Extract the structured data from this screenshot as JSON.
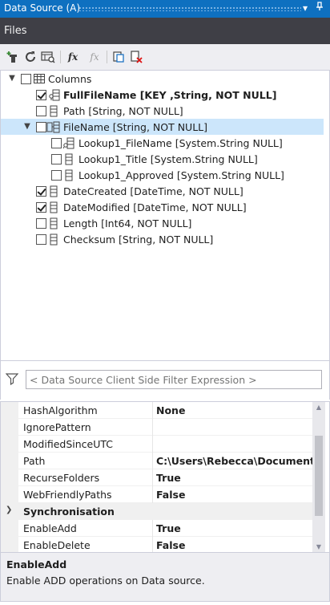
{
  "window": {
    "title": "Data Source (A)",
    "pin_icon": "pin-icon",
    "dropdown_icon": "dropdown-arrow-icon"
  },
  "tab": {
    "label": "Files"
  },
  "toolbar": {
    "buttons": [
      "add-column-icon",
      "refresh-icon",
      "preview-icon",
      "function-icon",
      "function-disabled-icon",
      "copy-icon",
      "delete-icon"
    ]
  },
  "tree": {
    "root": {
      "label": "Columns",
      "checked": false,
      "expanded": true
    },
    "items": [
      {
        "label": "FullFileName [KEY ,String, NOT NULL]",
        "checked": true,
        "bold": true,
        "icon": "key-field-icon"
      },
      {
        "label": "Path [String, NOT NULL]",
        "checked": false,
        "icon": "field-icon"
      },
      {
        "label": "FileName [String, NOT NULL]",
        "checked": false,
        "icon": "lookup-field-icon",
        "expanded": true,
        "selected": true
      },
      {
        "label": "Lookup1_FileName [System.String NULL]",
        "checked": false,
        "icon": "lookup-item-icon",
        "child": true
      },
      {
        "label": "Lookup1_Title [System.String NULL]",
        "checked": false,
        "icon": "field-icon",
        "child": true
      },
      {
        "label": "Lookup1_Approved [System.String NULL]",
        "checked": false,
        "icon": "field-icon",
        "child": true
      },
      {
        "label": "DateCreated [DateTime, NOT NULL]",
        "checked": true,
        "icon": "field-icon"
      },
      {
        "label": "DateModified [DateTime, NOT NULL]",
        "checked": true,
        "icon": "field-icon"
      },
      {
        "label": "Length [Int64, NOT NULL]",
        "checked": false,
        "icon": "field-icon"
      },
      {
        "label": "Checksum [String, NOT NULL]",
        "checked": false,
        "icon": "field-icon"
      }
    ]
  },
  "filter": {
    "placeholder": "< Data Source Client Side Filter Expression >",
    "icon": "filter-icon"
  },
  "properties": {
    "rows": [
      {
        "name": "HashAlgorithm",
        "value": "None"
      },
      {
        "name": "IgnorePattern",
        "value": ""
      },
      {
        "name": "ModifiedSinceUTC",
        "value": ""
      },
      {
        "name": "Path",
        "value": "C:\\Users\\Rebecca\\Documents\\D"
      },
      {
        "name": "RecurseFolders",
        "value": "True"
      },
      {
        "name": "WebFriendlyPaths",
        "value": "False"
      }
    ],
    "category": {
      "name": "Synchronisation"
    },
    "sync_rows": [
      {
        "name": "EnableAdd",
        "value": "True"
      },
      {
        "name": "EnableDelete",
        "value": "False"
      }
    ]
  },
  "description": {
    "title": "EnableAdd",
    "text": "Enable ADD operations on Data source."
  }
}
